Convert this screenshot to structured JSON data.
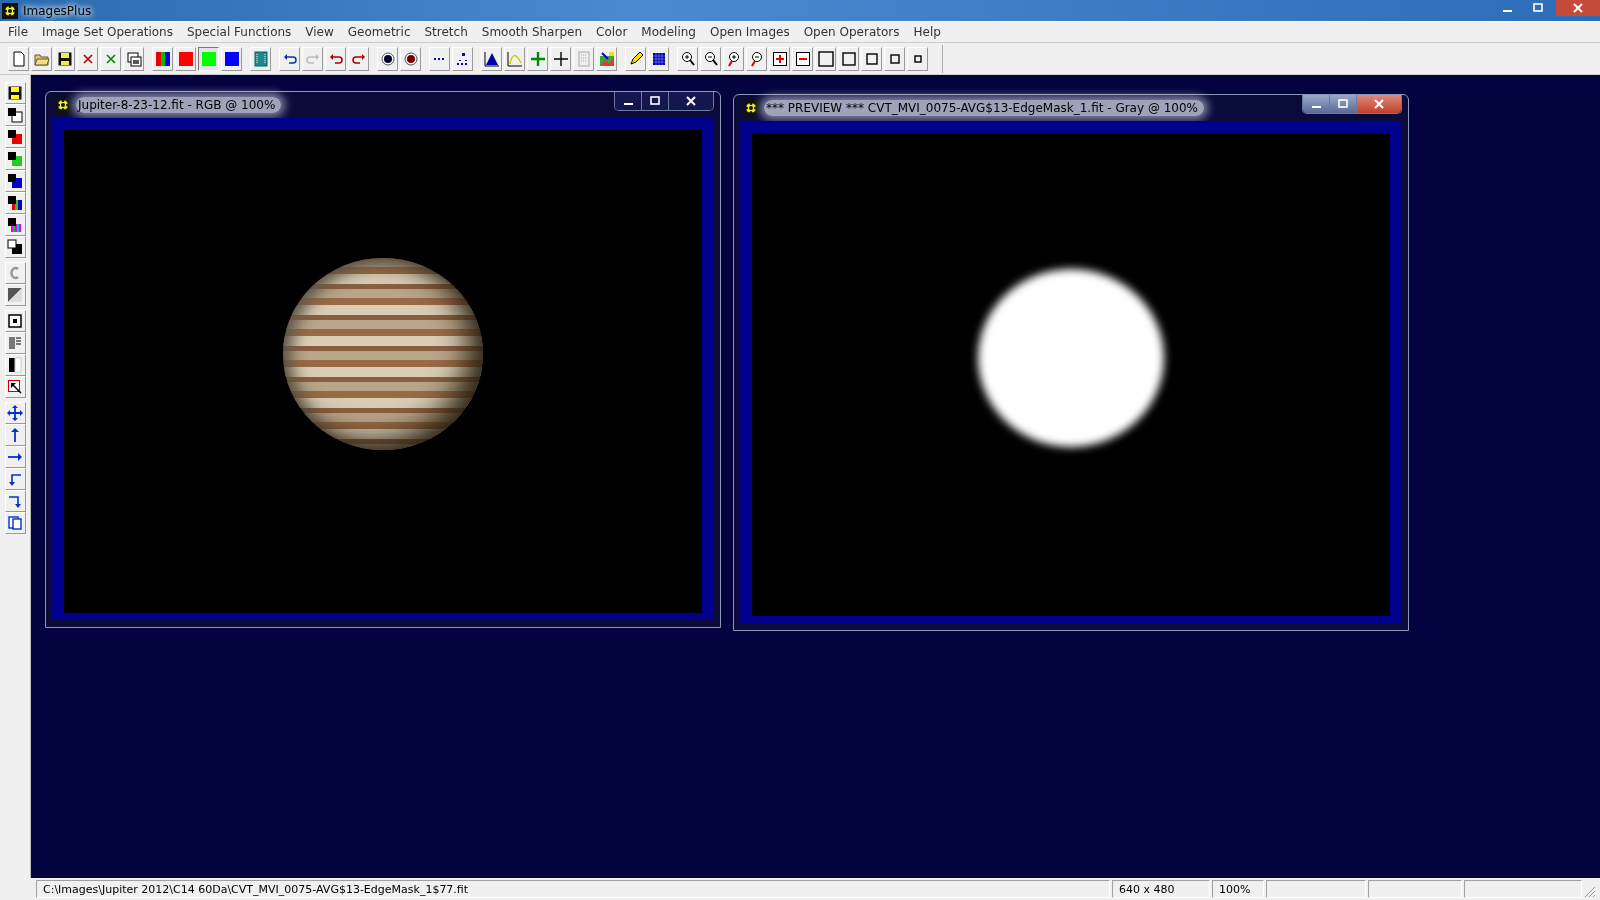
{
  "app": {
    "title": "ImagesPlus"
  },
  "menu": [
    "File",
    "Image Set Operations",
    "Special Functions",
    "View",
    "Geometric",
    "Stretch",
    "Smooth Sharpen",
    "Color",
    "Modeling",
    "Open Images",
    "Open Operators",
    "Help"
  ],
  "windows": [
    {
      "title": "Jupiter-8-23-12.fit - RGB @ 100%",
      "active": false,
      "kind": "planet"
    },
    {
      "title": "*** PREVIEW *** CVT_MVI_0075-AVG$13-EdgeMask_1.fit - Gray @ 100%",
      "active": true,
      "kind": "mask"
    }
  ],
  "status_bar": {
    "path": "C:\\Images\\Jupiter 2012\\C14 60Da\\CVT_MVI_0075-AVG$13-EdgeMask_1$77.fit",
    "size": "640 x 480",
    "zoom": "100%"
  }
}
